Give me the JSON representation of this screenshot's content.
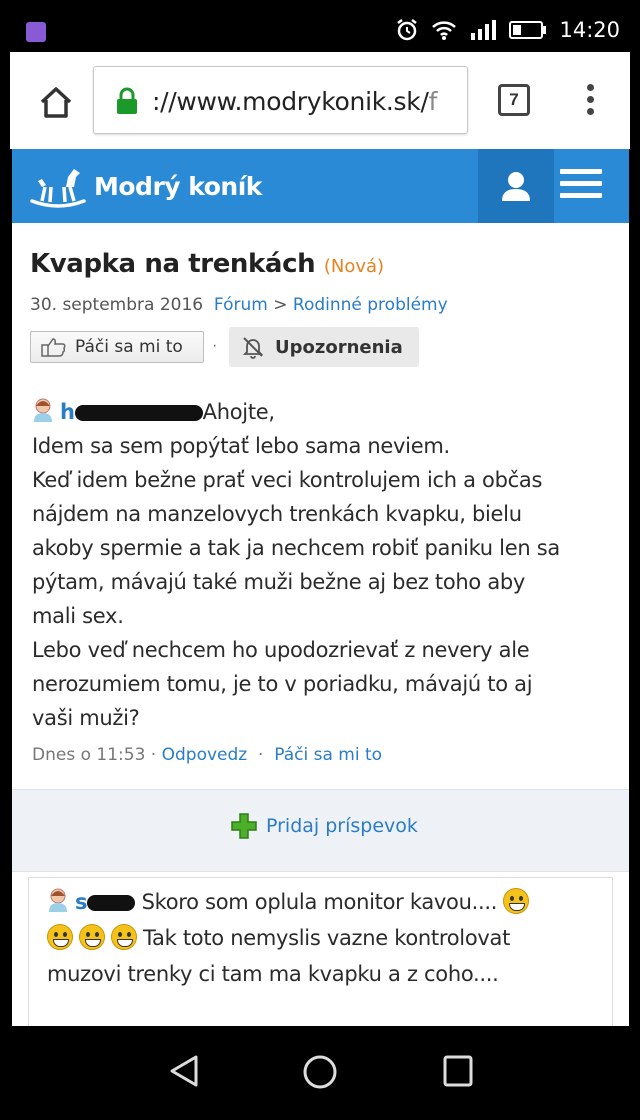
{
  "status_bar": {
    "time": "14:20"
  },
  "browser": {
    "url_main": "://www.modrykonik.sk/",
    "url_tail": "f",
    "tab_count": "7"
  },
  "site": {
    "name": "Modrý koník"
  },
  "thread": {
    "title": "Kvapka na trenkách",
    "badge": "(Nová)",
    "date": "30. septembra 2016",
    "crumb_forum": "Fórum",
    "crumb_sep": ">",
    "crumb_category": "Rodinné problémy",
    "like_label": "Páči sa mi to",
    "sep": "·",
    "notify_label": "Upozornenia"
  },
  "post": {
    "author_initial": "h",
    "lines": [
      "Ahojte,",
      "Idem sa sem popýtať lebo sama neviem.",
      "Keď idem bežne prať veci kontrolujem ich a občas",
      "nájdem na manzelovych trenkách kvapku, bielu",
      "akoby spermie a tak ja nechcem robiť paniku len sa",
      "pýtam, mávajú také muži bežne aj bez toho aby",
      "mali sex.",
      "Lebo veď nechcem ho upodozrievať z nevery ale",
      "nerozumiem tomu, je to v poriadku, mávajú to aj",
      "vaši muži?"
    ],
    "time": "Dnes o 11:53",
    "reply_label": "Odpovedz",
    "like_label": "Páči sa mi to",
    "dot": "·"
  },
  "add_post_label": "Pridaj príspevok",
  "reply": {
    "author_initial": "s",
    "text_1": "Skoro som oplula monitor kavou....",
    "text_2": "Tak toto nemyslis vazne kontrolovat",
    "text_3": "muzovi trenky ci tam ma kvapku a z coho...."
  },
  "colors": {
    "brand": "#2a8ad6",
    "link": "#2a7cc7",
    "badge": "#e8821e"
  },
  "icons": [
    "home-icon",
    "lock-icon",
    "tabs-icon",
    "overflow-menu-icon",
    "rocking-horse-logo-icon",
    "user-icon",
    "hamburger-icon",
    "thumbs-up-icon",
    "bell-off-icon",
    "avatar-icon",
    "plus-icon",
    "smiley-icon",
    "back-icon",
    "home-circle-icon",
    "recent-apps-icon"
  ]
}
